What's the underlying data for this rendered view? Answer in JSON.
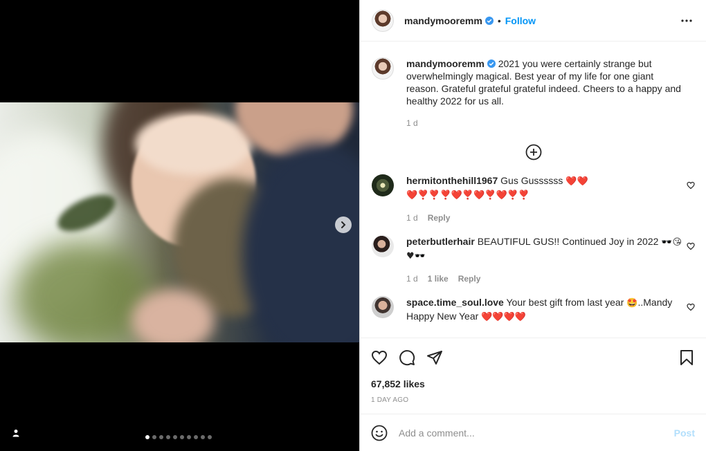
{
  "post": {
    "username": "mandymooremm",
    "follow_label": "Follow",
    "separator": "•",
    "caption": "2021 you were certainly strange but overwhelmingly magical. Best year of my life for one giant reason. Grateful grateful grateful indeed. Cheers to a happy and healthy 2022 for us all.",
    "caption_time": "1 d",
    "likes": "67,852 likes",
    "time_ago": "1 DAY AGO",
    "carousel": {
      "count": 10,
      "active_index": 0
    }
  },
  "comments": [
    {
      "username": "hermitonthehill1967",
      "text": "Gus Gussssss ",
      "emoji": "❤️❤️",
      "emoji2": "❤️❣️❣️❣️❤️❣️❤️❣️❤️❣️❣️",
      "time": "1 d",
      "reply": "Reply"
    },
    {
      "username": "peterbutlerhair",
      "text": "BEAUTIFUL GUS!! Continued Joy in 2022 ",
      "emoji": "🕶️😘",
      "emoji2": "♥🕶️",
      "time": "1 d",
      "likes": "1 like",
      "reply": "Reply"
    },
    {
      "username": "space.time_soul.love",
      "text": "Your best gift from last year ",
      "emoji": "🤩",
      "text2": "..Mandy Happy New Year ",
      "emoji2": "❤️❤️❤️❤️"
    }
  ],
  "add_comment": {
    "placeholder": "Add a comment...",
    "post_label": "Post"
  },
  "colors": {
    "accent": "#0095f6",
    "muted": "#8e8e8e",
    "post_disabled": "#b2dffc"
  }
}
